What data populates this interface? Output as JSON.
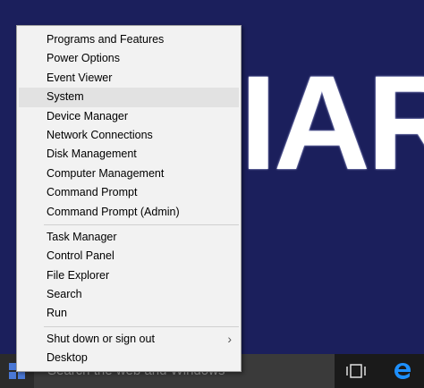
{
  "background": {
    "text": "IAR"
  },
  "menu": {
    "groups": [
      [
        "Programs and Features",
        "Power Options",
        "Event Viewer",
        "System",
        "Device Manager",
        "Network Connections",
        "Disk Management",
        "Computer Management",
        "Command Prompt",
        "Command Prompt (Admin)"
      ],
      [
        "Task Manager",
        "Control Panel",
        "File Explorer",
        "Search",
        "Run"
      ],
      [
        "Shut down or sign out",
        "Desktop"
      ]
    ],
    "highlighted": "System",
    "submenu_indicator": "›"
  },
  "taskbar": {
    "search_placeholder": "Search the web and Windows",
    "icons": [
      "windows-logo-icon",
      "task-view-icon",
      "edge-icon"
    ]
  },
  "colors": {
    "desktop": "#1b1f5c",
    "taskbar": "#1a1a1a",
    "menu": "#f2f2f2",
    "highlight": "#e2e2e2",
    "windows_logo": "#4a78d6",
    "edge": "#1e90ff"
  }
}
